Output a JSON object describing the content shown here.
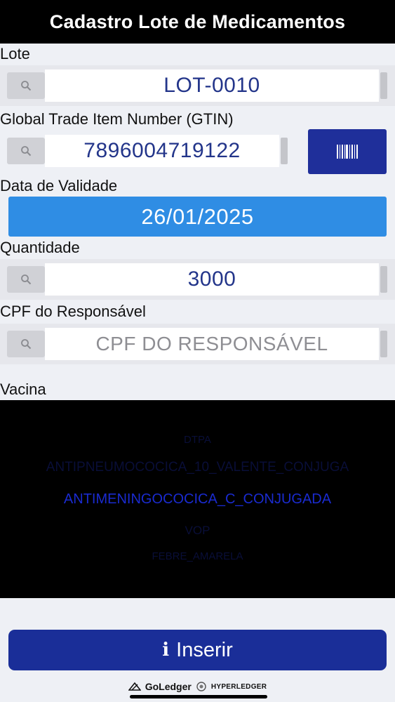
{
  "header": {
    "title": "Cadastro Lote de Medicamentos"
  },
  "form": {
    "lote": {
      "label": "Lote",
      "value": "LOT-0010"
    },
    "gtin": {
      "label": "Global Trade Item Number (GTIN)",
      "value": "7896004719122"
    },
    "validade": {
      "label": "Data de Validade",
      "value": "26/01/2025"
    },
    "quantidade": {
      "label": "Quantidade",
      "value": "3000"
    },
    "cpf": {
      "label": "CPF do Responsável",
      "placeholder": "CPF DO RESPONSÁVEL"
    },
    "vacina": {
      "label": "Vacina",
      "options": [
        "DTPA",
        "ANTIPNEUMOCOCICA_10_VALENTE_CONJUGA",
        "ANTIMENINGOCOCICA_C_CONJUGADA",
        "VOP",
        "FEBRE_AMARELA"
      ],
      "selected": "ANTIMENINGOCOCICA_C_CONJUGADA"
    }
  },
  "actions": {
    "insert_label": "Inserir"
  },
  "footer": {
    "brand1": "GoLedger",
    "brand2": "HYPERLEDGER"
  },
  "icons": {
    "search": "search-icon",
    "barcode": "barcode-icon",
    "info": "info-icon"
  }
}
